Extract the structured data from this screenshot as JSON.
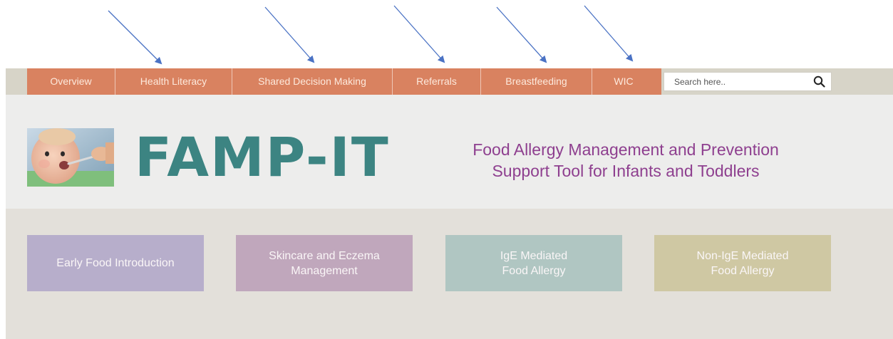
{
  "nav": {
    "items": [
      {
        "label": "Overview",
        "name": "nav-item-overview",
        "width": 124
      },
      {
        "label": "Health Literacy",
        "name": "nav-item-health-literacy",
        "width": 164
      },
      {
        "label": "Shared Decision Making",
        "name": "nav-item-shared-decision-making",
        "width": 225
      },
      {
        "label": "Referrals",
        "name": "nav-item-referrals",
        "width": 124
      },
      {
        "label": "Breastfeeding",
        "name": "nav-item-breastfeeding",
        "width": 156
      },
      {
        "label": "WIC",
        "name": "nav-item-wic",
        "width": 88
      }
    ],
    "color": "#d98260"
  },
  "search": {
    "placeholder": "Search here..",
    "icon": "search-icon"
  },
  "header": {
    "logo": "FAMP-IT",
    "tagline_line1": "Food Allergy Management and Prevention",
    "tagline_line2": "Support Tool for Infants and Toddlers",
    "logo_color": "#3c8482",
    "tagline_color": "#8e3f8f"
  },
  "tiles": [
    {
      "line1": "Early Food Introduction",
      "line2": "",
      "color": "#b7aecb",
      "name": "tile-early-food-introduction"
    },
    {
      "line1": "Skincare and Eczema",
      "line2": "Management",
      "color": "#c0a7bc",
      "name": "tile-skincare-eczema-management"
    },
    {
      "line1": "IgE Mediated",
      "line2": "Food Allergy",
      "color": "#b0c6c2",
      "name": "tile-ige-mediated-food-allergy"
    },
    {
      "line1": "Non-IgE Mediated",
      "line2": "Food Allergy",
      "color": "#cfc8a3",
      "name": "tile-non-ige-mediated-food-allergy"
    }
  ],
  "annotation": {
    "arrow_color": "#4a72c4",
    "arrow_count": 5
  }
}
